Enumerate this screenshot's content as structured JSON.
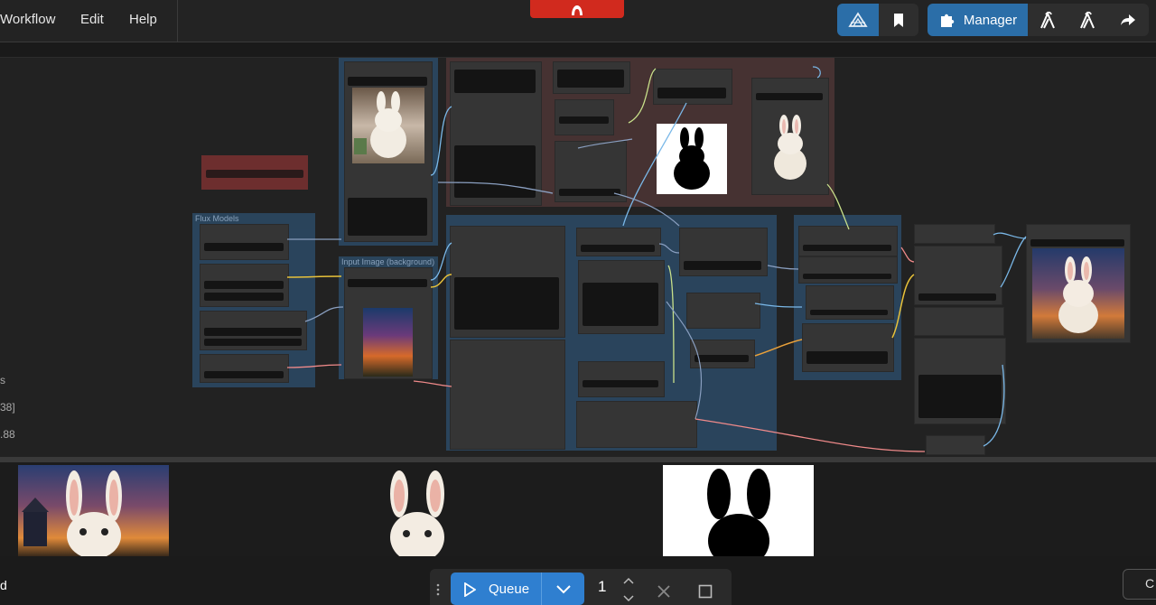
{
  "menu": {
    "items": [
      "Workflow",
      "Edit",
      "Help"
    ]
  },
  "toolbar": {
    "manager_label": "Manager",
    "accent": "#2b6ea8"
  },
  "side_stats": [
    "s",
    "38]",
    ".88"
  ],
  "groups": [
    {
      "title": "Flux Models",
      "color": "#2c4a66"
    },
    {
      "title": "Input Image (background)",
      "color": "#2c4a66"
    },
    {
      "title": "",
      "color": "#4a3434"
    },
    {
      "title": "",
      "color": "#2c4a66"
    },
    {
      "title": "",
      "color": "#2c4a66"
    },
    {
      "title": "",
      "color": "#7a3030"
    }
  ],
  "queue": {
    "label": "Queue",
    "count": "1",
    "color": "#2f7fd0"
  },
  "left_edge_text": "d",
  "right_edge_text": "C"
}
